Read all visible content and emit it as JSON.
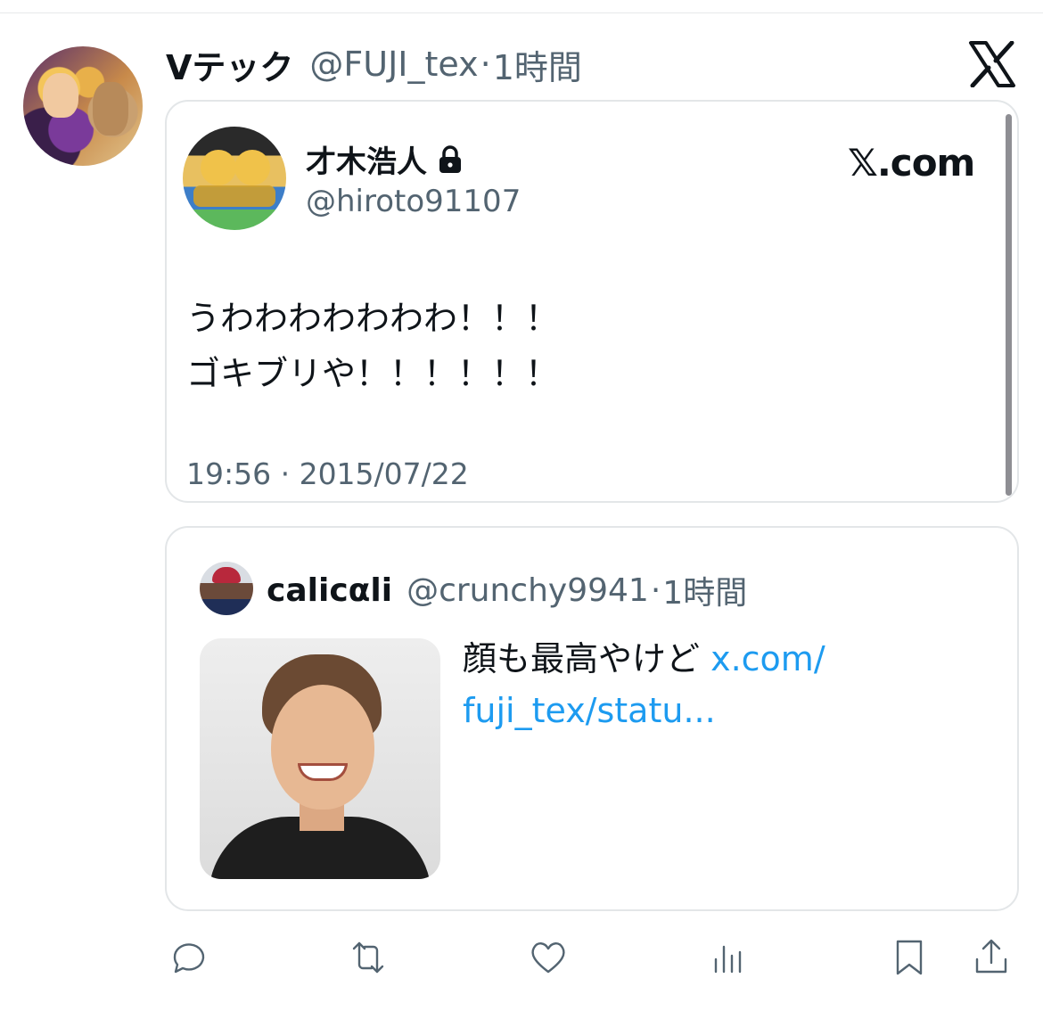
{
  "tweet": {
    "display_name": "Vテック",
    "handle": "@FUJI_tex",
    "separator": "·",
    "time": "1時間"
  },
  "embedded_card": {
    "display_name": "才木浩人",
    "handle": "@hiroto91107",
    "source_label": "𝕏.com",
    "text": "うわわわわわわわ！！！\nゴキブリや！！！！！！",
    "date": "19:56 · 2015/07/22"
  },
  "quote": {
    "display_name": "calicαli",
    "handle": "@crunchy9941",
    "separator": "·",
    "time": "1時間",
    "text": "顔も最高やけど ",
    "link_text": "x.com/\nfuji_tex/statu..."
  },
  "icons": {
    "header": "x-logo-icon",
    "lock": "lock-icon",
    "actions": [
      "reply-icon",
      "retweet-icon",
      "like-icon",
      "views-icon",
      "bookmark-icon",
      "share-icon"
    ]
  },
  "colors": {
    "text": "#0f1419",
    "secondary": "#536471",
    "link": "#1d9bf0",
    "border": "#e3e6e8"
  }
}
